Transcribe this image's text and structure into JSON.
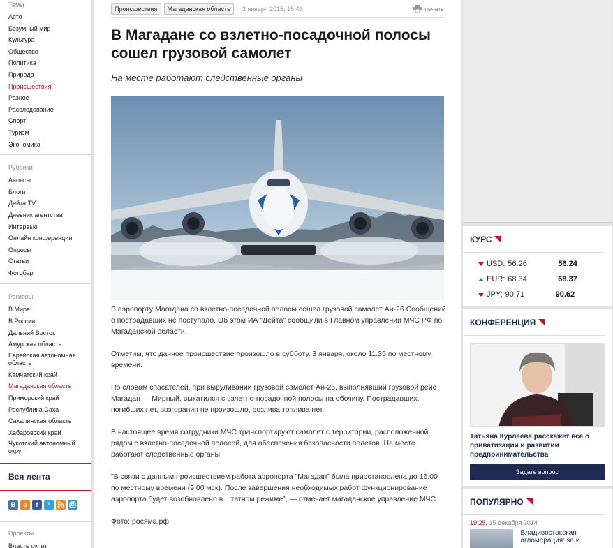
{
  "left": {
    "themes_title": "Темы",
    "themes": [
      "Авто",
      "Безумный мир",
      "Культура",
      "Общество",
      "Политика",
      "Природа",
      "Происшествия",
      "Разное",
      "Расследование",
      "Спорт",
      "Туризм",
      "Экономика"
    ],
    "rubrics_title": "Рубрики",
    "rubrics": [
      "Анонсы",
      "Блоги",
      "Дейта.TV",
      "Дневник агентства",
      "Интервью",
      "Онлайн конференции",
      "Опросы",
      "Статьи",
      "Фотобар"
    ],
    "regions_title": "Регионы",
    "regions": [
      "В Мире",
      "В России",
      "Дальний Восток",
      "Амурская область",
      "Еврейская автономная область",
      "Камчатский край",
      "Магаданская область",
      "Приморский край",
      "Республика Саха",
      "Сахалинская область",
      "Хабаровский край",
      "Чукотский автономный округ"
    ],
    "all_feed": "Вся лента",
    "social": [
      "В",
      "о",
      "f",
      "t",
      "rss",
      "ig"
    ],
    "projects_title": "Проекты",
    "projects_first": "Власть рулит"
  },
  "article": {
    "tags": [
      "Происшествия",
      "Магаданская область"
    ],
    "date": "3 января 2015, 15:46",
    "print": "печать",
    "title": "В Магадане со взлетно-посадочной полосы сошел грузовой самолет",
    "lead": "На месте работают следственные органы",
    "paragraphs": [
      "В аэропорту Магадана со взлетно-посадочной полосы сошел грузовой самолет Ан-26.Сообщений о пострадавших не поступало. Об этом ИА \"Дейта\" сообщили в Главном управлении МЧС РФ по Магаданской области.",
      "Отметим, что данное происшествие произошло в субботу, 3 января, около 11.35 по местному времени.",
      "По словам спасателей, при выруливании грузовой самолет Ан-26, выполнявший грузовой рейс Магадан — Мирный, выкатился с взлетно-посадочной полосы на обочину. Пострадавших, погибших нет, возгорания не произошло, розлива топлива нет.",
      "В настоящее время сотрудники МЧС транспортируют самолет с территории, расположенной рядом с взлетно-посадочной полосой, для обеспечения безопасности полетов. На месте работают следственные органы.",
      "\"В связи с данным происшествием работа аэропорта \"Магадан\" была приостановлена до 16.00 по местному времени (9.00 мск). После завершения необходимых работ функционирование аэропорта будет возобновлено в штатном режиме\", — отмечает магаданское управление МЧС.",
      "Фото: росяма.рф"
    ]
  },
  "rates": {
    "title": "КУРС",
    "items": [
      {
        "code": "USD:",
        "old": "56.26",
        "new": "56.24",
        "dir": "down"
      },
      {
        "code": "EUR:",
        "old": "68.34",
        "new": "68.37",
        "dir": "up"
      },
      {
        "code": "JPY:",
        "old": "90.71",
        "new": "90.62",
        "dir": "down"
      }
    ]
  },
  "conference": {
    "title": "КОНФЕРЕНЦИЯ",
    "caption": "Татьяна Курлеева расскажет всё о приватизации и развитии предпринимательства",
    "button": "Задать вопрос"
  },
  "popular": {
    "title": "ПОПУЛЯРНО",
    "time": "19:25,",
    "date": "15 декабря 2014",
    "item_title": "Владивостокская агломерация: за и"
  },
  "colors": {
    "accent": "#c4122f",
    "navy": "#1d2b52"
  }
}
